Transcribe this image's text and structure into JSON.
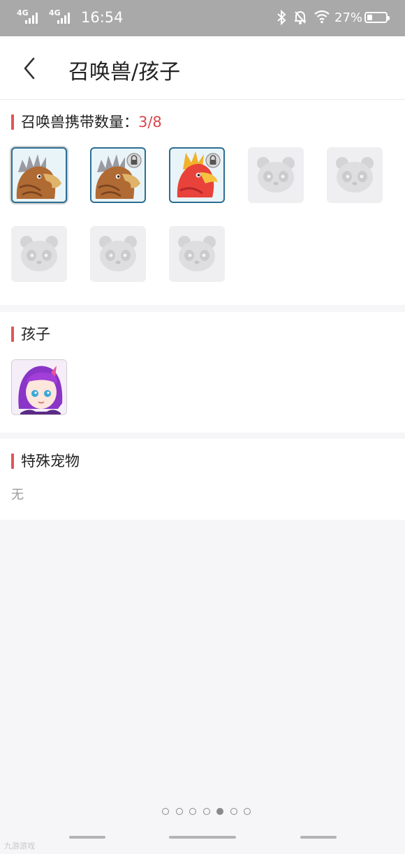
{
  "status_bar": {
    "net1": "4G",
    "net2": "4G",
    "time": "16:54",
    "battery_percent": "27%",
    "battery_level": 0.27,
    "icons": [
      "bluetooth-icon",
      "mute-bell-icon",
      "wifi-icon",
      "battery-icon"
    ]
  },
  "header": {
    "title": "召唤兽/孩子",
    "back_icon": "chevron-left-icon"
  },
  "summons": {
    "title": "召唤兽携带数量：",
    "count": "3/8",
    "slots": [
      {
        "state": "filled",
        "creature": "brown-eagle",
        "locked": false,
        "selected": true
      },
      {
        "state": "filled",
        "creature": "brown-eagle",
        "locked": true,
        "selected": false
      },
      {
        "state": "filled",
        "creature": "red-phoenix",
        "locked": true,
        "selected": false
      },
      {
        "state": "empty",
        "icon": "panda-placeholder-icon"
      },
      {
        "state": "empty",
        "icon": "panda-placeholder-icon"
      },
      {
        "state": "empty",
        "icon": "panda-placeholder-icon"
      },
      {
        "state": "empty",
        "icon": "panda-placeholder-icon"
      },
      {
        "state": "empty",
        "icon": "panda-placeholder-icon"
      }
    ]
  },
  "children": {
    "title": "孩子",
    "items": [
      {
        "avatar": "purple-haired-girl"
      }
    ]
  },
  "special_pets": {
    "title": "特殊宠物",
    "empty_text": "无"
  },
  "pager": {
    "count": 7,
    "active_index": 4
  },
  "watermark": "九游游戏",
  "colors": {
    "accent": "#e0565b",
    "count_red": "#d9474c",
    "status_bar": "#a9a9a9",
    "slot_border": "#2a6f93"
  }
}
